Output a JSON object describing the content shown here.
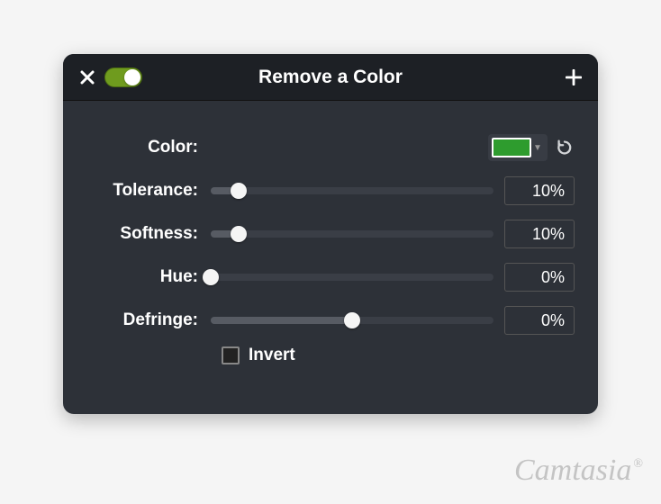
{
  "header": {
    "title": "Remove a Color",
    "toggle_on": true
  },
  "color": {
    "label": "Color:",
    "swatch": "#2e9c2e"
  },
  "sliders": [
    {
      "label": "Tolerance:",
      "value": "10%",
      "percent": 10
    },
    {
      "label": "Softness:",
      "value": "10%",
      "percent": 10
    },
    {
      "label": "Hue:",
      "value": "0%",
      "percent": 0
    },
    {
      "label": "Defringe:",
      "value": "0%",
      "percent": 50
    }
  ],
  "invert": {
    "label": "Invert",
    "checked": false
  },
  "watermark": "Camtasia"
}
